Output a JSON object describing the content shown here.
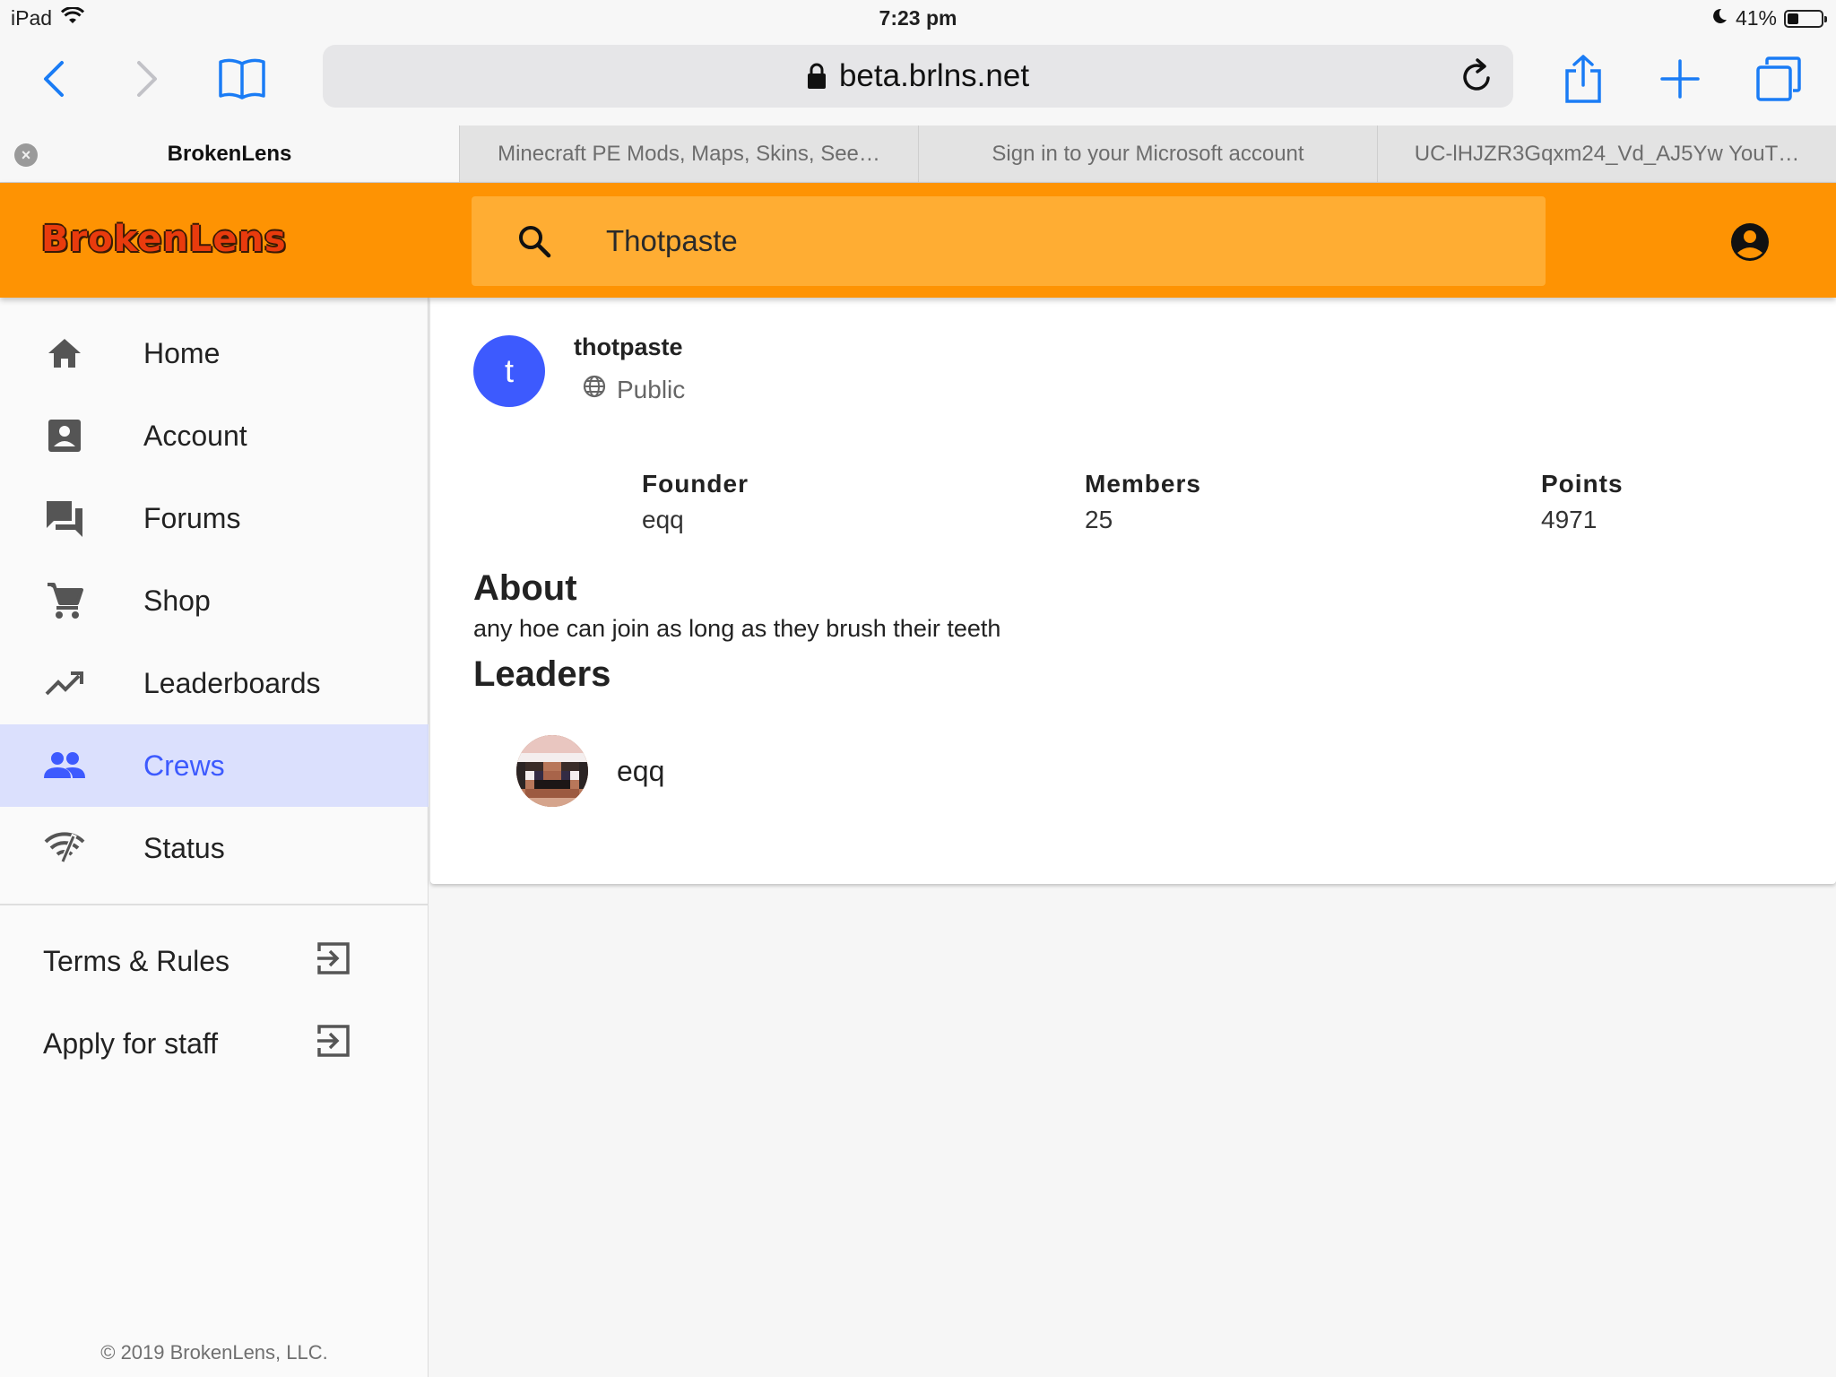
{
  "status_bar": {
    "device": "iPad",
    "time": "7:23 pm",
    "battery": "41%",
    "battery_level": 0.41
  },
  "browser": {
    "url": "beta.brlns.net",
    "tabs": [
      {
        "label": "BrokenLens",
        "active": true
      },
      {
        "label": "Minecraft PE Mods, Maps, Skins, See…",
        "active": false
      },
      {
        "label": "Sign in to your Microsoft account",
        "active": false
      },
      {
        "label": "UC-lHJZR3Gqxm24_Vd_AJ5Yw YouT…",
        "active": false
      }
    ]
  },
  "header": {
    "logo": "BrokenLens",
    "search_value": "Thotpaste"
  },
  "sidebar": {
    "items": [
      {
        "label": "Home",
        "icon": "home-icon"
      },
      {
        "label": "Account",
        "icon": "account-box-icon"
      },
      {
        "label": "Forums",
        "icon": "forum-icon"
      },
      {
        "label": "Shop",
        "icon": "cart-icon"
      },
      {
        "label": "Leaderboards",
        "icon": "trending-up-icon"
      },
      {
        "label": "Crews",
        "icon": "people-icon",
        "active": true
      },
      {
        "label": "Status",
        "icon": "signal-icon"
      }
    ],
    "external": [
      {
        "label": "Terms & Rules",
        "icon": "exit-icon"
      },
      {
        "label": "Apply for staff",
        "icon": "exit-icon"
      }
    ],
    "copyright": "© 2019 BrokenLens, LLC."
  },
  "crew": {
    "avatar_letter": "t",
    "name": "thotpaste",
    "visibility": "Public",
    "stats": [
      {
        "label": "Founder",
        "value": "eqq"
      },
      {
        "label": "Members",
        "value": "25"
      },
      {
        "label": "Points",
        "value": "4971"
      }
    ],
    "about_title": "About",
    "about_text": "any hoe can join as long as they brush their teeth",
    "leaders_title": "Leaders",
    "leaders": [
      {
        "name": "eqq"
      }
    ]
  },
  "colors": {
    "brand_orange": "#fe9303",
    "search_bg": "#ffad33",
    "accent_blue": "#3d5afe",
    "active_nav_bg": "#dbe0fd",
    "ios_blue": "#1a7cf5"
  }
}
